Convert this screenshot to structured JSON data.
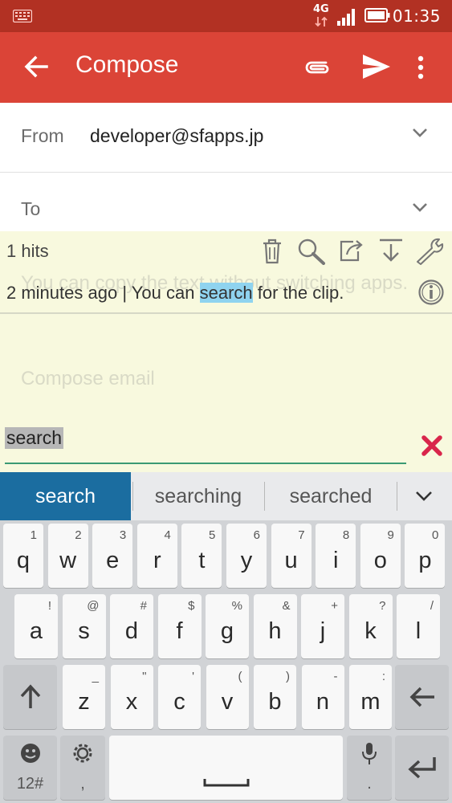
{
  "status_bar": {
    "network": "4G",
    "time": "01:35"
  },
  "app_bar": {
    "title": "Compose"
  },
  "header": {
    "from_label": "From",
    "from_value": "developer@sfapps.jp",
    "to_label": "To"
  },
  "body": {
    "subject_text": "You can copy the text without switching apps.",
    "compose_placeholder": "Compose email"
  },
  "clip_overlay": {
    "hits": "1 hits",
    "item": {
      "time": "2 minutes ago",
      "separator": "|",
      "before": "You can",
      "match": "search",
      "after": "for the clip."
    },
    "search_value": "search"
  },
  "suggestions": [
    {
      "label": "search"
    },
    {
      "label": "searching"
    },
    {
      "label": "searched"
    }
  ],
  "keyboard": {
    "row1": [
      {
        "letter": "q",
        "hint": "1"
      },
      {
        "letter": "w",
        "hint": "2"
      },
      {
        "letter": "e",
        "hint": "3"
      },
      {
        "letter": "r",
        "hint": "4"
      },
      {
        "letter": "t",
        "hint": "5"
      },
      {
        "letter": "y",
        "hint": "6"
      },
      {
        "letter": "u",
        "hint": "7"
      },
      {
        "letter": "i",
        "hint": "8"
      },
      {
        "letter": "o",
        "hint": "9"
      },
      {
        "letter": "p",
        "hint": "0"
      }
    ],
    "row2": [
      {
        "letter": "a",
        "hint": "!"
      },
      {
        "letter": "s",
        "hint": "@"
      },
      {
        "letter": "d",
        "hint": "#"
      },
      {
        "letter": "f",
        "hint": "$"
      },
      {
        "letter": "g",
        "hint": "%"
      },
      {
        "letter": "h",
        "hint": "&"
      },
      {
        "letter": "j",
        "hint": "+"
      },
      {
        "letter": "k",
        "hint": "?"
      },
      {
        "letter": "l",
        "hint": "/"
      }
    ],
    "row3": [
      {
        "letter": "z",
        "hint": "_"
      },
      {
        "letter": "x",
        "hint": "\""
      },
      {
        "letter": "c",
        "hint": "'"
      },
      {
        "letter": "v",
        "hint": "("
      },
      {
        "letter": "b",
        "hint": ")"
      },
      {
        "letter": "n",
        "hint": "-"
      },
      {
        "letter": "m",
        "hint": ":"
      }
    ],
    "symbols_label": "12#",
    "comma_label": ",",
    "period_label": "."
  },
  "colors": {
    "status_bar": "#b23123",
    "app_bar": "#db4437",
    "overlay": "#f8f9de",
    "suggestion_selected": "#1b6da0",
    "close_x": "#d9264b"
  }
}
